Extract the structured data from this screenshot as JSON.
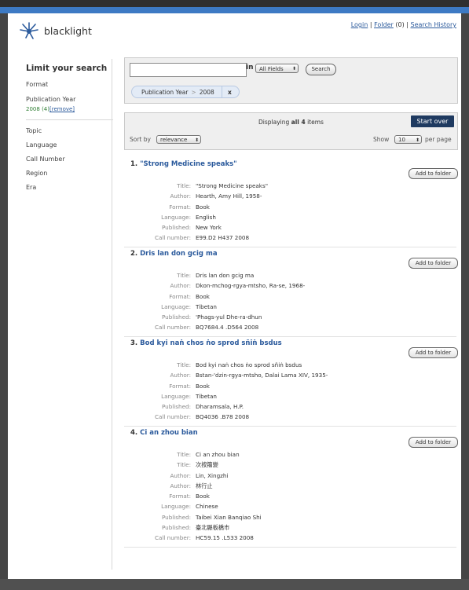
{
  "header": {
    "logo_text": "blacklight",
    "links": {
      "login": "Login",
      "sep1": "|",
      "folder": "Folder",
      "folder_count": "(0)",
      "sep2": "|",
      "history": "Search History"
    }
  },
  "sidebar": {
    "title": "Limit your search",
    "facets_top": [
      {
        "label": "Format"
      },
      {
        "label": "Publication Year"
      }
    ],
    "selected": {
      "value": "2008",
      "count": "(4)",
      "remove": "[remove]"
    },
    "facets": [
      {
        "label": "Topic"
      },
      {
        "label": "Language"
      },
      {
        "label": "Call Number"
      },
      {
        "label": "Region"
      },
      {
        "label": "Era"
      }
    ]
  },
  "search": {
    "query": "",
    "in_label": "in",
    "field": "All Fields",
    "button": "Search",
    "constraint": {
      "field": "Publication Year",
      "sep": ">",
      "value": "2008",
      "remove": "x"
    }
  },
  "results_bar": {
    "displaying_prefix": "Displaying ",
    "displaying_bold": "all 4",
    "displaying_suffix": " items",
    "start_over": "Start over",
    "sort_label": "Sort by",
    "sort_value": "relevance",
    "show_label": "Show",
    "per_page_value": "10",
    "per_page_label": "per page"
  },
  "add_label": "Add to folder",
  "results": [
    {
      "num": "1.",
      "title": "\"Strong Medicine speaks\"",
      "fields": [
        {
          "k": "Title:",
          "v": "\"Strong Medicine speaks\""
        },
        {
          "k": "Author:",
          "v": "Hearth, Amy Hill, 1958-"
        },
        {
          "k": "Format:",
          "v": "Book"
        },
        {
          "k": "Language:",
          "v": "English"
        },
        {
          "k": "Published:",
          "v": "New York"
        },
        {
          "k": "Call number:",
          "v": "E99.D2 H437 2008"
        }
      ]
    },
    {
      "num": "2.",
      "title": "Dris lan don gcig ma",
      "fields": [
        {
          "k": "Title:",
          "v": "Dris lan don gcig ma"
        },
        {
          "k": "Author:",
          "v": "Dkon-mchog-rgya-mtsho, Ra-se, 1968-"
        },
        {
          "k": "Format:",
          "v": "Book"
        },
        {
          "k": "Language:",
          "v": "Tibetan"
        },
        {
          "k": "Published:",
          "v": "'Phags-yul Dhe-ra-dhun"
        },
        {
          "k": "Call number:",
          "v": "BQ7684.4 .D564 2008"
        }
      ]
    },
    {
      "num": "3.",
      "title": "Bod kyi naṅ chos ṅo sprod sñiṅ bsdus",
      "fields": [
        {
          "k": "Title:",
          "v": "Bod kyi naṅ chos ṅo sprod sñiṅ bsdus"
        },
        {
          "k": "Author:",
          "v": "Bstan-'dzin-rgya-mtsho, Dalai Lama XIV, 1935-"
        },
        {
          "k": "Format:",
          "v": "Book"
        },
        {
          "k": "Language:",
          "v": "Tibetan"
        },
        {
          "k": "Published:",
          "v": "Dharamsala, H.P."
        },
        {
          "k": "Call number:",
          "v": "BQ4036 .B78 2008"
        }
      ]
    },
    {
      "num": "4.",
      "title": "Ci an zhou bian",
      "fields": [
        {
          "k": "Title:",
          "v": "Ci an zhou bian"
        },
        {
          "k": "Title:",
          "v": "次按籀變"
        },
        {
          "k": "Author:",
          "v": "Lin, Xingzhi"
        },
        {
          "k": "Author:",
          "v": "林行止"
        },
        {
          "k": "Format:",
          "v": "Book"
        },
        {
          "k": "Language:",
          "v": "Chinese"
        },
        {
          "k": "Published:",
          "v": "Taibei Xian Banqiao Shi"
        },
        {
          "k": "Published:",
          "v": "臺北縣板橋市"
        },
        {
          "k": "Call number:",
          "v": "HC59.15 .L533 2008"
        }
      ]
    }
  ]
}
